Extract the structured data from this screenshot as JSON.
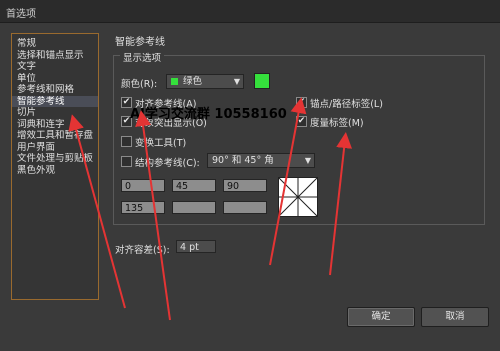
{
  "window": {
    "title": "首选项"
  },
  "sidebar": {
    "items": [
      {
        "label": "常规"
      },
      {
        "label": "选择和锚点显示"
      },
      {
        "label": "文字"
      },
      {
        "label": "单位"
      },
      {
        "label": "参考线和网格"
      },
      {
        "label": "智能参考线",
        "selected": true
      },
      {
        "label": "切片"
      },
      {
        "label": "词典和连字"
      },
      {
        "label": "增效工具和暂存盘"
      },
      {
        "label": "用户界面"
      },
      {
        "label": "文件处理与剪贴板"
      },
      {
        "label": "黑色外观"
      }
    ]
  },
  "panel": {
    "title": "智能参考线",
    "display_options": {
      "title": "显示选项",
      "color_label": "颜色(R):",
      "color_value": "绿色",
      "color_hex": "#35e03c",
      "checkboxes": {
        "align_guides": {
          "label": "对齐参考线(A)",
          "checked": true
        },
        "anchor_labels": {
          "label": "锚点/路径标签(L)",
          "checked": true
        },
        "object_highlight": {
          "label": "对象突出显示(O)",
          "checked": true
        },
        "measure_labels": {
          "label": "度量标签(M)",
          "checked": true
        },
        "transform_tools": {
          "label": "变换工具(T)",
          "checked": false
        },
        "construction_guides": {
          "label": "结构参考线(C):",
          "checked": false
        }
      },
      "construction_angles": "90° 和 45° 角",
      "angle_fields": [
        "0",
        "45",
        "90",
        "135",
        "",
        ""
      ]
    },
    "snapping_tolerance": {
      "label": "对齐容差(S):",
      "value": "4 pt"
    }
  },
  "buttons": {
    "ok": "确定",
    "cancel": "取消"
  },
  "overlay": {
    "watermark": "AI学习交流群 10558160"
  }
}
